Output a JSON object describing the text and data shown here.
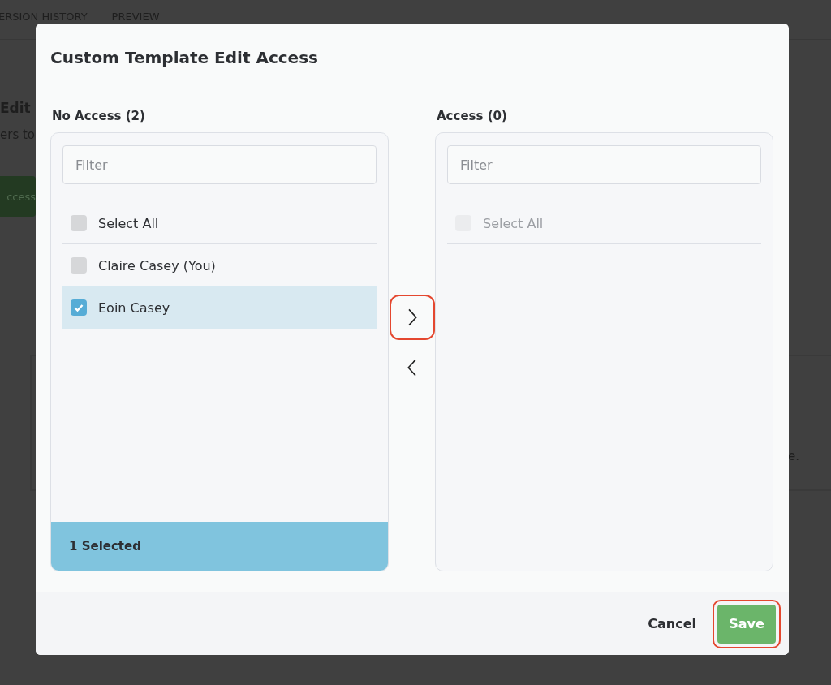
{
  "background": {
    "tabs": [
      "ERSION HISTORY",
      "PREVIEW"
    ],
    "heading": "Edit",
    "text": "ers to",
    "button": "ccess",
    "note": "e."
  },
  "dialog": {
    "title": "Custom Template Edit Access",
    "lists": [
      {
        "label": "No Access (2)",
        "filter": {
          "placeholder": "Filter"
        },
        "select_all": {
          "label": "Select All",
          "checked": false,
          "disabled": false
        },
        "items": [
          {
            "label": "Claire Casey (You)",
            "checked": false
          },
          {
            "label": "Eoin Casey",
            "checked": true
          }
        ],
        "footer": "1 Selected"
      },
      {
        "label": "Access (0)",
        "filter": {
          "placeholder": "Filter"
        },
        "select_all": {
          "label": "Select All",
          "checked": false,
          "disabled": true
        }
      }
    ],
    "move_buttons": [
      {
        "kind": "right",
        "highlighted": true
      },
      {
        "kind": "left",
        "highlighted": false
      }
    ],
    "buttons": [
      {
        "label": "Cancel",
        "kind": "text",
        "highlighted": false
      },
      {
        "label": "Save",
        "kind": "primary",
        "highlighted": true
      }
    ]
  }
}
